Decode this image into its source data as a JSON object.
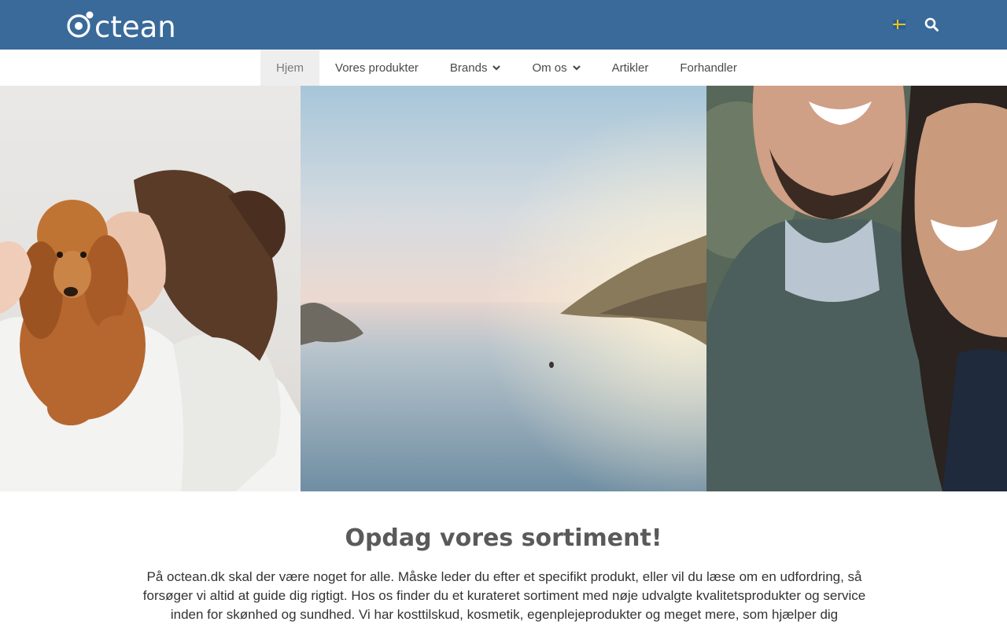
{
  "header": {
    "logo_text": "octean",
    "language_flag": "sweden-flag-icon",
    "search_icon": "search-icon"
  },
  "nav": {
    "items": [
      {
        "label": "Hjem",
        "active": true,
        "has_dropdown": false
      },
      {
        "label": "Vores produkter",
        "active": false,
        "has_dropdown": false
      },
      {
        "label": "Brands",
        "active": false,
        "has_dropdown": true
      },
      {
        "label": "Om os",
        "active": false,
        "has_dropdown": true
      },
      {
        "label": "Artikler",
        "active": false,
        "has_dropdown": false
      },
      {
        "label": "Forhandler",
        "active": false,
        "has_dropdown": false
      }
    ]
  },
  "hero": {
    "images": [
      {
        "name": "woman-with-dog-image"
      },
      {
        "name": "sea-sunset-image"
      },
      {
        "name": "smiling-couple-image"
      }
    ]
  },
  "main": {
    "heading": "Opdag vores sortiment!",
    "intro": "På octean.dk skal der være noget for alle. Måske leder du efter et specifikt produkt, eller vil du læse om en udfordring, så forsøger vi altid at guide dig rigtigt. Hos os finder du et kurateret sortiment med nøje udvalgte kvalitetsprodukter og service inden for skønhed og sundhed. Vi har kosttilskud, kosmetik, egenplejeprodukter og meget mere, som hjælper dig"
  },
  "colors": {
    "header_bg": "#3a6a9a",
    "nav_active_bg": "#eeeeee",
    "heading_text": "#5a5a5a"
  }
}
